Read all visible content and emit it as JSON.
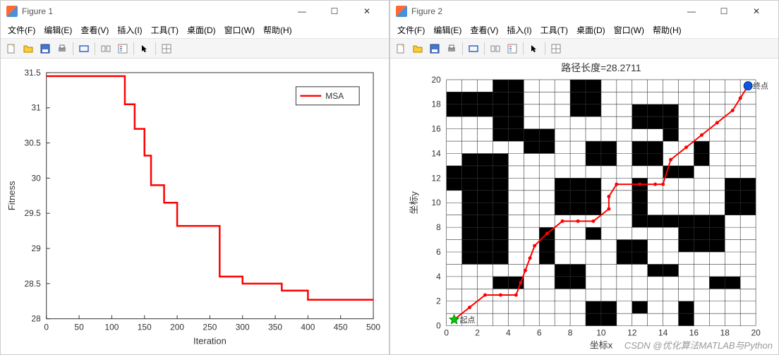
{
  "windows": [
    {
      "title": "Figure 1"
    },
    {
      "title": "Figure 2"
    }
  ],
  "menu": [
    "文件(F)",
    "编辑(E)",
    "查看(V)",
    "插入(I)",
    "工具(T)",
    "桌面(D)",
    "窗口(W)",
    "帮助(H)"
  ],
  "legend1": "MSA",
  "xlabel1": "Iteration",
  "ylabel1": "Fitness",
  "title2": "路径长度=28.2711",
  "xlabel2": "坐标x",
  "ylabel2": "坐标y",
  "startLabel": "起点",
  "endLabel": "终点",
  "watermark": "CSDN @优化算法MATLAB与Python",
  "chart_data": [
    {
      "type": "line",
      "title": "",
      "xlabel": "Iteration",
      "ylabel": "Fitness",
      "xlim": [
        0,
        500
      ],
      "ylim": [
        28,
        31.5
      ],
      "xticks": [
        0,
        50,
        100,
        150,
        200,
        250,
        300,
        350,
        400,
        450,
        500
      ],
      "yticks": [
        28,
        28.5,
        29,
        29.5,
        30,
        30.5,
        31,
        31.5
      ],
      "series": [
        {
          "name": "MSA",
          "color": "#ff0000",
          "x": [
            0,
            120,
            120,
            135,
            135,
            150,
            150,
            160,
            160,
            180,
            180,
            200,
            200,
            215,
            215,
            265,
            265,
            300,
            300,
            360,
            360,
            400,
            400,
            500
          ],
          "y": [
            31.45,
            31.45,
            31.05,
            31.05,
            30.7,
            30.7,
            30.32,
            30.32,
            29.9,
            29.9,
            29.65,
            29.65,
            29.32,
            29.32,
            29.32,
            29.32,
            28.6,
            28.6,
            28.5,
            28.5,
            28.4,
            28.4,
            28.27,
            28.27
          ]
        }
      ],
      "legend_position": "right"
    },
    {
      "type": "grid_path",
      "title": "路径长度=28.2711",
      "xlabel": "坐标x",
      "ylabel": "坐标y",
      "xlim": [
        0,
        20
      ],
      "ylim": [
        0,
        20
      ],
      "xticks": [
        0,
        2,
        4,
        6,
        8,
        10,
        12,
        14,
        16,
        18,
        20
      ],
      "yticks": [
        0,
        2,
        4,
        6,
        8,
        10,
        12,
        14,
        16,
        18,
        20
      ],
      "obstacles": [
        [
          0,
          11
        ],
        [
          0,
          12
        ],
        [
          0,
          17
        ],
        [
          0,
          18
        ],
        [
          1,
          5
        ],
        [
          1,
          6
        ],
        [
          1,
          7
        ],
        [
          1,
          8
        ],
        [
          1,
          9
        ],
        [
          1,
          10
        ],
        [
          1,
          11
        ],
        [
          1,
          12
        ],
        [
          1,
          13
        ],
        [
          1,
          17
        ],
        [
          1,
          18
        ],
        [
          2,
          5
        ],
        [
          2,
          6
        ],
        [
          2,
          7
        ],
        [
          2,
          8
        ],
        [
          2,
          9
        ],
        [
          2,
          10
        ],
        [
          2,
          11
        ],
        [
          2,
          12
        ],
        [
          2,
          13
        ],
        [
          2,
          17
        ],
        [
          2,
          18
        ],
        [
          3,
          3
        ],
        [
          3,
          5
        ],
        [
          3,
          6
        ],
        [
          3,
          7
        ],
        [
          3,
          8
        ],
        [
          3,
          9
        ],
        [
          3,
          10
        ],
        [
          3,
          11
        ],
        [
          3,
          12
        ],
        [
          3,
          13
        ],
        [
          3,
          15
        ],
        [
          3,
          16
        ],
        [
          3,
          17
        ],
        [
          3,
          18
        ],
        [
          3,
          19
        ],
        [
          4,
          3
        ],
        [
          4,
          15
        ],
        [
          4,
          16
        ],
        [
          4,
          17
        ],
        [
          4,
          18
        ],
        [
          4,
          19
        ],
        [
          5,
          14
        ],
        [
          5,
          15
        ],
        [
          6,
          5
        ],
        [
          6,
          6
        ],
        [
          6,
          7
        ],
        [
          6,
          14
        ],
        [
          6,
          15
        ],
        [
          7,
          3
        ],
        [
          7,
          4
        ],
        [
          7,
          9
        ],
        [
          7,
          10
        ],
        [
          7,
          11
        ],
        [
          8,
          3
        ],
        [
          8,
          4
        ],
        [
          8,
          9
        ],
        [
          8,
          10
        ],
        [
          8,
          11
        ],
        [
          8,
          17
        ],
        [
          8,
          18
        ],
        [
          8,
          19
        ],
        [
          9,
          0
        ],
        [
          9,
          1
        ],
        [
          9,
          7
        ],
        [
          9,
          9
        ],
        [
          9,
          10
        ],
        [
          9,
          11
        ],
        [
          9,
          13
        ],
        [
          9,
          14
        ],
        [
          9,
          17
        ],
        [
          9,
          18
        ],
        [
          9,
          19
        ],
        [
          10,
          0
        ],
        [
          10,
          1
        ],
        [
          10,
          13
        ],
        [
          10,
          14
        ],
        [
          11,
          5
        ],
        [
          11,
          6
        ],
        [
          12,
          1
        ],
        [
          12,
          5
        ],
        [
          12,
          6
        ],
        [
          12,
          8
        ],
        [
          12,
          9
        ],
        [
          12,
          10
        ],
        [
          12,
          11
        ],
        [
          12,
          13
        ],
        [
          12,
          14
        ],
        [
          12,
          16
        ],
        [
          12,
          17
        ],
        [
          13,
          4
        ],
        [
          13,
          8
        ],
        [
          13,
          13
        ],
        [
          13,
          14
        ],
        [
          13,
          16
        ],
        [
          13,
          17
        ],
        [
          14,
          4
        ],
        [
          14,
          8
        ],
        [
          14,
          12
        ],
        [
          14,
          15
        ],
        [
          14,
          16
        ],
        [
          14,
          17
        ],
        [
          15,
          0
        ],
        [
          15,
          1
        ],
        [
          15,
          6
        ],
        [
          15,
          7
        ],
        [
          15,
          8
        ],
        [
          15,
          12
        ],
        [
          16,
          6
        ],
        [
          16,
          7
        ],
        [
          16,
          8
        ],
        [
          16,
          13
        ],
        [
          16,
          14
        ],
        [
          17,
          3
        ],
        [
          17,
          6
        ],
        [
          17,
          7
        ],
        [
          17,
          8
        ],
        [
          18,
          3
        ],
        [
          18,
          9
        ],
        [
          18,
          10
        ],
        [
          18,
          11
        ],
        [
          19,
          9
        ],
        [
          19,
          10
        ],
        [
          19,
          11
        ]
      ],
      "path": [
        [
          0.5,
          0.5
        ],
        [
          1.5,
          1.5
        ],
        [
          2.5,
          2.5
        ],
        [
          3.5,
          2.5
        ],
        [
          4.5,
          2.5
        ],
        [
          4.8,
          3.5
        ],
        [
          5.1,
          4.5
        ],
        [
          5.4,
          5.5
        ],
        [
          5.7,
          6.5
        ],
        [
          6.5,
          7.5
        ],
        [
          7.5,
          8.5
        ],
        [
          8.5,
          8.5
        ],
        [
          9.5,
          8.5
        ],
        [
          10.5,
          9.5
        ],
        [
          10.5,
          10.5
        ],
        [
          11.0,
          11.5
        ],
        [
          12.5,
          11.5
        ],
        [
          13.5,
          11.5
        ],
        [
          14,
          11.5
        ],
        [
          14.5,
          13.5
        ],
        [
          15.5,
          14.5
        ],
        [
          16.5,
          15.5
        ],
        [
          17.5,
          16.5
        ],
        [
          18.5,
          17.5
        ],
        [
          19,
          18.5
        ],
        [
          19.5,
          19.5
        ]
      ],
      "start": [
        0.5,
        0.5
      ],
      "end": [
        19.5,
        19.5
      ]
    }
  ]
}
